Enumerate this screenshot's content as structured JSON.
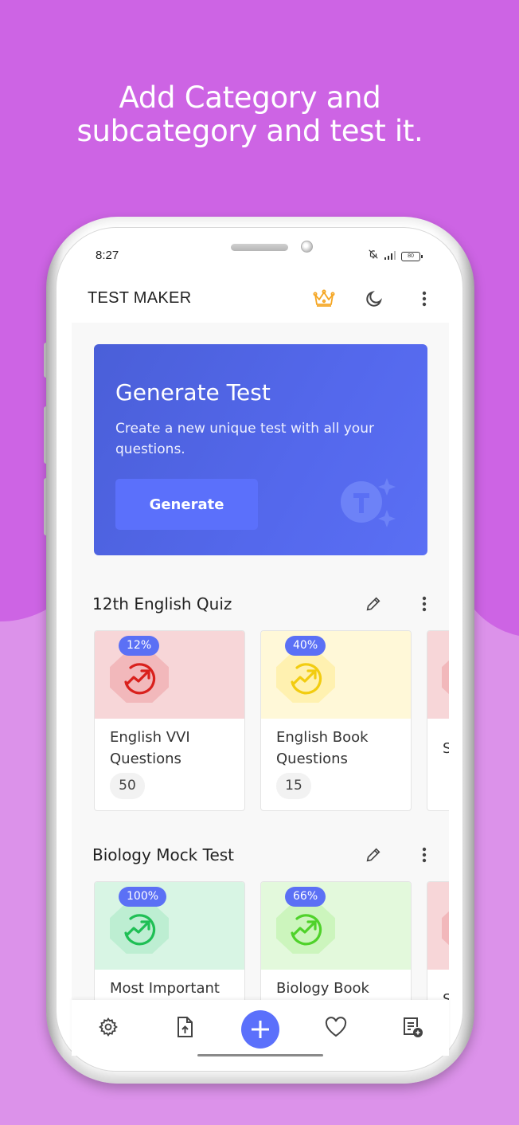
{
  "promo": {
    "headline_line1": "Add Category and",
    "headline_line2": "subcategory and test it."
  },
  "status_bar": {
    "time": "8:27",
    "battery": "80",
    "icons": [
      "bell-off-icon",
      "signal-icon",
      "battery-icon"
    ]
  },
  "app_bar": {
    "title": "TEST MAKER",
    "actions": [
      "crown-premium-icon",
      "dark-mode-moon-icon",
      "more-vert-icon"
    ]
  },
  "generate_card": {
    "title": "Generate Test",
    "description": "Create a new unique test with all your questions.",
    "button_label": "Generate"
  },
  "categories": [
    {
      "title": "12th English Quiz",
      "subcategories": [
        {
          "name": "English VVI Questions",
          "progress": "12%",
          "count": "50",
          "color": "#d9201c",
          "bg": "#f7d6d8",
          "oct": "#f2b8bb"
        },
        {
          "name": "English Book Questions",
          "progress": "40%",
          "count": "15",
          "color": "#f2cc10",
          "bg": "#fff8d8",
          "oct": "#fff1b0"
        },
        {
          "name": "S",
          "progress": "",
          "count": "",
          "color": "#d9201c",
          "bg": "#f7d6d8",
          "oct": "#f2b8bb"
        }
      ]
    },
    {
      "title": "Biology Mock Test",
      "subcategories": [
        {
          "name": "Most Important",
          "progress": "100%",
          "count": "",
          "color": "#1fbf55",
          "bg": "#d8f5e4",
          "oct": "#bdeed2"
        },
        {
          "name": "Biology Book",
          "progress": "66%",
          "count": "",
          "color": "#4fd22a",
          "bg": "#e3f9dc",
          "oct": "#ccf5bd"
        },
        {
          "name": "S",
          "progress": "",
          "count": "",
          "color": "#d9201c",
          "bg": "#f7d6d8",
          "oct": "#f2b8bb"
        }
      ]
    }
  ],
  "bottom_nav": {
    "items": [
      "settings-icon",
      "file-upload-icon",
      "add-icon",
      "favorite-heart-icon",
      "note-add-icon"
    ]
  },
  "colors": {
    "accent": "#5b70fb",
    "background_purple": "#cd64e4",
    "crown": "#f5a623"
  }
}
